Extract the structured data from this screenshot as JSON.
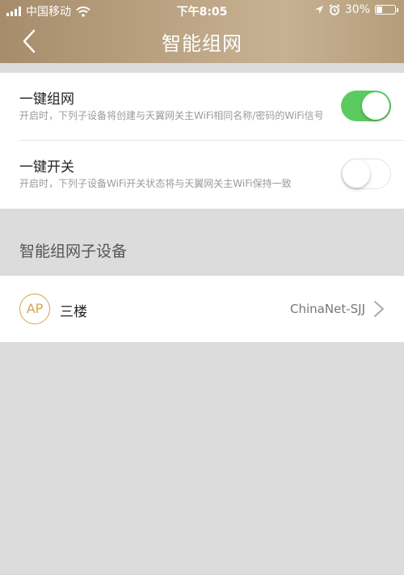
{
  "status_bar": {
    "carrier": "中国移动",
    "time": "下午8:05",
    "battery_text": "30%",
    "battery_level": 0.3,
    "icons": [
      "signal-icon",
      "wifi-icon",
      "location-icon",
      "alarm-icon",
      "battery-icon"
    ]
  },
  "nav": {
    "title": "智能组网",
    "back_icon": "chevron-left-icon"
  },
  "settings": [
    {
      "title": "一键组网",
      "description": "开启时，下列子设备将创建与天翼网关主WiFi相同名称/密码的WiFi信号",
      "enabled": true
    },
    {
      "title": "一键开关",
      "description": "开启时，下列子设备WiFi开关状态将与天翼网关主WiFi保持一致",
      "enabled": false
    }
  ],
  "section": {
    "label": "智能组网子设备"
  },
  "devices": [
    {
      "badge": "AP",
      "name": "三楼",
      "ssid": "ChinaNet-SJJ"
    }
  ],
  "colors": {
    "header_gold": "#b8a07e",
    "toggle_on": "#5ccb5f",
    "ap_badge": "#d2a64d",
    "background": "#dcdcdc"
  }
}
